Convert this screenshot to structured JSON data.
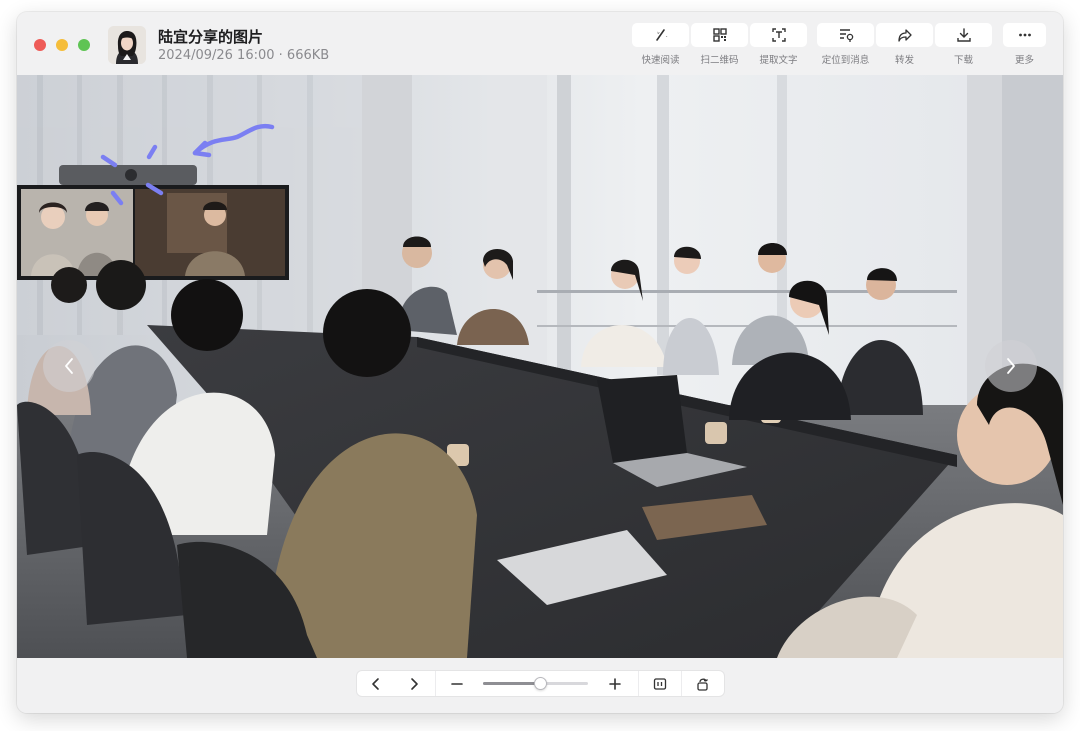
{
  "window": {
    "title": "陆宜分享的图片",
    "subtitle": "2024/09/26 16:00 · 666KB"
  },
  "toolbar": {
    "items": [
      {
        "label": "快速阅读",
        "icon": "quick-read-icon"
      },
      {
        "label": "扫二维码",
        "icon": "qr-code-icon"
      },
      {
        "label": "提取文字",
        "icon": "extract-text-icon"
      },
      {
        "label": "定位到消息",
        "icon": "locate-message-icon"
      },
      {
        "label": "转发",
        "icon": "forward-icon"
      },
      {
        "label": "下载",
        "icon": "download-icon"
      },
      {
        "label": "更多",
        "icon": "more-icon"
      }
    ]
  },
  "viewer": {
    "image_subject": "business meeting room with video conference screen"
  },
  "zoom": {
    "level": 0.55
  },
  "colors": {
    "window_bg": "#f1f1f2",
    "traffic_red": "#ee5b57",
    "traffic_yellow": "#f5bd3a",
    "traffic_green": "#5fc454",
    "annotation": "#7b7ff2"
  }
}
